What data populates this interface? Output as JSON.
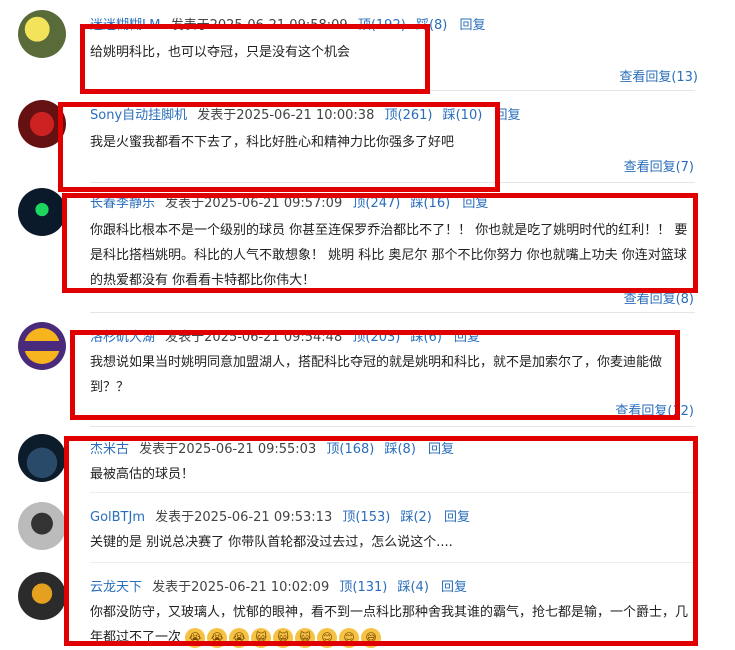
{
  "comments": [
    {
      "user": "迷迷糊糊LM",
      "posted": "发表于2025-06-21 09:58:09",
      "ding": "顶(192)",
      "cai": "踩(8)",
      "reply": "回复",
      "text": "给姚明科比，也可以夺冠，只是没有这个机会",
      "view_replies": "查看回复(13)"
    },
    {
      "user": "Sony自动挂脚机",
      "posted": "发表于2025-06-21 10:00:38",
      "ding": "顶(261)",
      "cai": "踩(10)",
      "reply": "回复",
      "text": "我是火蜜我都看不下去了，科比好胜心和精神力比你强多了好吧",
      "view_replies": "查看回复(7)"
    },
    {
      "user": "长春李静乐",
      "posted": "发表于2025-06-21 09:57:09",
      "ding": "顶(247)",
      "cai": "踩(16)",
      "reply": "回复",
      "text": "你跟科比根本不是一个级别的球员 你甚至连保罗乔治都比不了！！ 你也就是吃了姚明时代的红利！！ 要是科比搭档姚明。科比的人气不敢想象！ 姚明 科比 奥尼尔 那个不比你努力 你也就嘴上功夫 你连对篮球的热爱都没有 你看看卡特都比你伟大！",
      "view_replies": "查看回复(8)"
    },
    {
      "user": "洛杉矶大湖",
      "posted": "发表于2025-06-21 09:54:48",
      "ding": "顶(203)",
      "cai": "踩(6)",
      "reply": "回复",
      "text": "我想说如果当时姚明同意加盟湖人，搭配科比夺冠的就是姚明和科比，就不是加索尔了，你麦迪能做到？？",
      "view_replies": "查看回复(12)"
    },
    {
      "user": "杰米古",
      "posted": "发表于2025-06-21 09:55:03",
      "ding": "顶(168)",
      "cai": "踩(8)",
      "reply": "回复",
      "text": "最被高估的球员！",
      "view_replies": ""
    },
    {
      "user": "GolBTJm",
      "posted": "发表于2025-06-21 09:53:13",
      "ding": "顶(153)",
      "cai": "踩(2)",
      "reply": "回复",
      "text": "关键的是 别说总决赛了 你带队首轮都没过去过，怎么说这个....",
      "view_replies": ""
    },
    {
      "user": "云龙天下",
      "posted": "发表于2025-06-21 10:02:09",
      "ding": "顶(131)",
      "cai": "踩(4)",
      "reply": "回复",
      "text": "你都没防守，又玻璃人，忧郁的眼神，看不到一点科比那种舍我其谁的霸气，抢七都是输，一个爵士，几年都过不了一次",
      "view_replies": ""
    }
  ],
  "colors": {
    "highlight": "#e00000",
    "link": "#2a6ebb"
  }
}
